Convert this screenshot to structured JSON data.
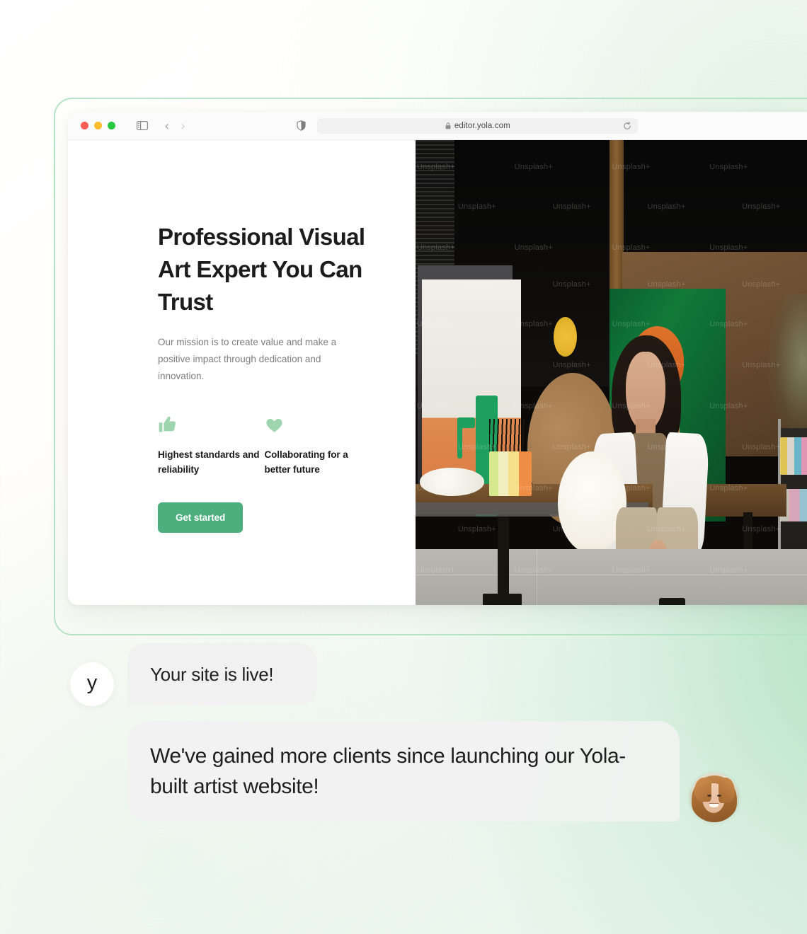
{
  "browser": {
    "window_controls": [
      "close",
      "minimize",
      "zoom"
    ],
    "sidebar_toggle_icon": "sidebar-icon",
    "back_label": "‹",
    "forward_label": "›",
    "shield_icon": "shield-icon",
    "lock_icon": "lock-icon",
    "url": "editor.yola.com",
    "reload_icon": "reload-icon"
  },
  "site": {
    "headline": "Professional Visual Art Expert You Can Trust",
    "subtext": "Our mission is to create value and make a positive impact through dedication and innovation.",
    "features": [
      {
        "icon": "thumbs-up-icon",
        "label": "Highest standards and reliability"
      },
      {
        "icon": "heart-icon",
        "label": "Collaborating for a better future"
      }
    ],
    "cta_label": "Get started",
    "hero_image": {
      "alt": "Female artist sitting in a painting studio surrounded by canvases, brushes and paint bottles",
      "watermark": "Unsplash+"
    }
  },
  "chat": {
    "brand_mark": "y",
    "messages": [
      {
        "from": "yola",
        "text": "Your site is live!"
      },
      {
        "from": "customer",
        "text": "We've gained more clients since launching our Yola-built artist website!"
      }
    ],
    "customer_avatar": "smiling-woman-portrait"
  },
  "colors": {
    "accent_green": "#4caf7d",
    "icon_green": "#9fd5ae",
    "frame_green": "#b6e3c3",
    "bubble_grey": "#f1f1f1",
    "heading_dark": "#1c1c1c",
    "body_grey": "#7d7d7d"
  }
}
